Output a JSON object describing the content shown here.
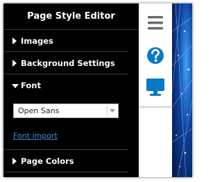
{
  "panel": {
    "title": "Page Style Editor",
    "sections": [
      {
        "label": "Images",
        "expanded": false
      },
      {
        "label": "Background Settings",
        "expanded": false
      },
      {
        "label": "Font",
        "expanded": true
      },
      {
        "label": "Page Colors",
        "expanded": false
      }
    ],
    "font_select_value": "Open Sans",
    "font_import_link": "Font import"
  },
  "toolbar": {
    "icons": [
      "hamburger-menu-icon",
      "help-icon",
      "monitor-icon"
    ]
  },
  "colors": {
    "panel_bg": "#000000",
    "accent_blue": "#0a79c8",
    "link_blue": "#4a8fd9",
    "icon_gray": "#6b6b6b"
  }
}
